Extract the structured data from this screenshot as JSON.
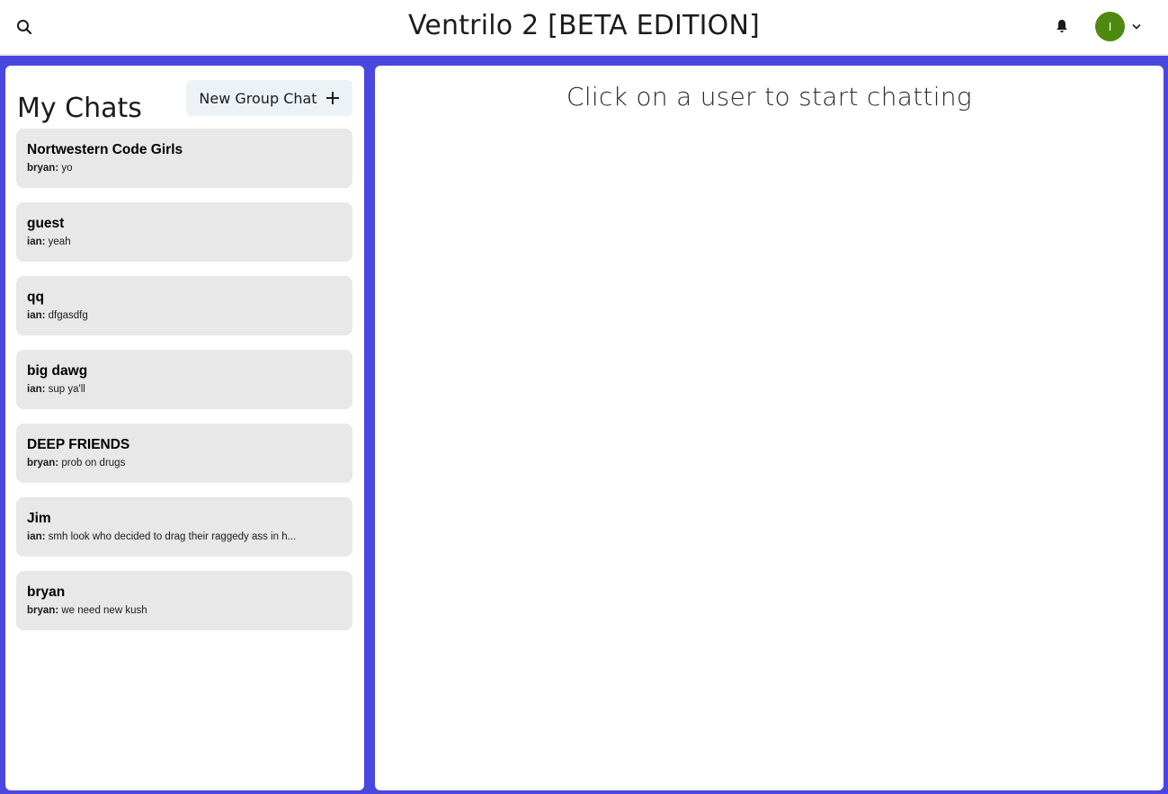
{
  "header": {
    "title": "Ventrilo 2 [BETA EDITION]",
    "search_icon": "search-icon",
    "notification_icon": "bell-icon",
    "user_initial": "I",
    "avatar_color": "#4f8a10"
  },
  "sidebar": {
    "title": "My Chats",
    "new_group_label": "New Group Chat",
    "chats": [
      {
        "name": "Nortwestern Code Girls",
        "sender": "bryan:",
        "message": "yo"
      },
      {
        "name": "guest",
        "sender": "ian:",
        "message": "yeah"
      },
      {
        "name": "qq",
        "sender": "ian:",
        "message": "dfgasdfg"
      },
      {
        "name": "big dawg",
        "sender": "ian:",
        "message": "sup ya'll"
      },
      {
        "name": "DEEP FRIENDS",
        "sender": "bryan:",
        "message": "prob on drugs"
      },
      {
        "name": "Jim",
        "sender": "ian:",
        "message": "smh look who decided to drag their raggedy ass in h..."
      },
      {
        "name": "bryan",
        "sender": "bryan:",
        "message": "we need new kush"
      }
    ]
  },
  "main": {
    "empty_message": "Click on a user to start chatting"
  },
  "colors": {
    "background_accent": "#4a46e0",
    "chat_item_bg": "#e8e8e8",
    "button_bg": "#edf2f7"
  }
}
